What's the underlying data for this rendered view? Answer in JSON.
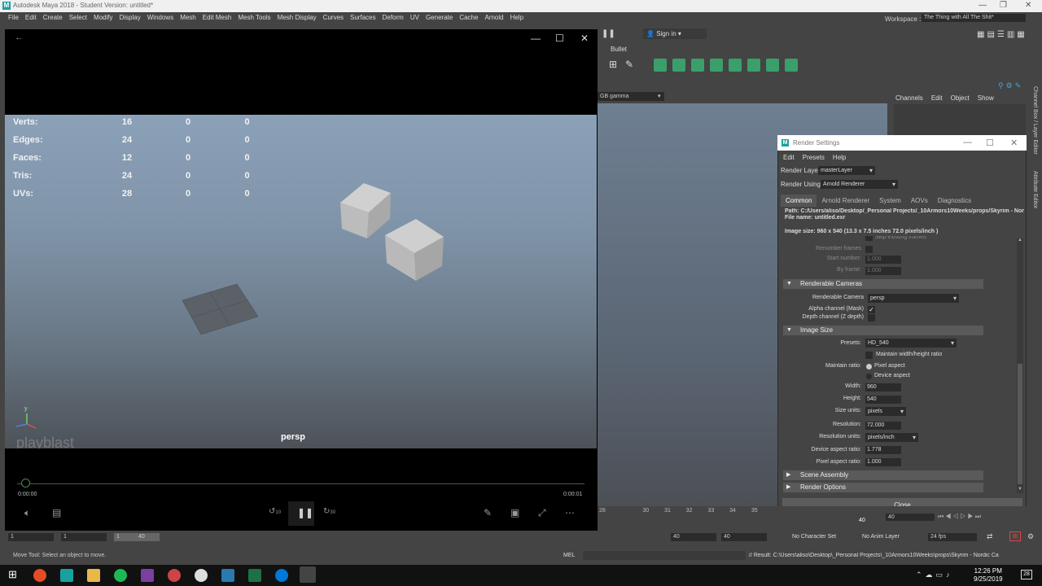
{
  "app": {
    "title": "Autodesk Maya 2018 - Student Version: untitled*",
    "logo_letter": "M",
    "menu": [
      "File",
      "Edit",
      "Create",
      "Select",
      "Modify",
      "Display",
      "Windows",
      "Mesh",
      "Edit Mesh",
      "Mesh Tools",
      "Mesh Display",
      "Curves",
      "Surfaces",
      "Deform",
      "UV",
      "Generate",
      "Cache",
      "Arnold",
      "Help"
    ],
    "workspace_label": "Workspace :",
    "workspace_value": "The Thing with All The Shit*",
    "sign_in": "Sign in",
    "shelf_tab": "Bullet",
    "gamma": "GB gamma",
    "channel_tabs": [
      "Channels",
      "Edit",
      "Object",
      "Show"
    ],
    "side_tabs": [
      "Channel Box / Layer Editor",
      "Attribute Editor"
    ]
  },
  "player": {
    "hud": [
      {
        "label": "Verts:",
        "v1": "16",
        "v2": "0",
        "v3": "0"
      },
      {
        "label": "Edges:",
        "v1": "24",
        "v2": "0",
        "v3": "0"
      },
      {
        "label": "Faces:",
        "v1": "12",
        "v2": "0",
        "v3": "0"
      },
      {
        "label": "Tris:",
        "v1": "24",
        "v2": "0",
        "v3": "0"
      },
      {
        "label": "UVs:",
        "v1": "28",
        "v2": "0",
        "v3": "0"
      }
    ],
    "camera": "persp",
    "watermark": "playblast",
    "time_start": "0:00:00",
    "time_end": "0:00:01",
    "skip_back": "10",
    "skip_fwd": "30",
    "axis_y": "y"
  },
  "render_settings": {
    "title": "Render Settings",
    "menu": [
      "Edit",
      "Presets",
      "Help"
    ],
    "render_layer_label": "Render Layer",
    "render_layer": "masterLayer",
    "render_using_label": "Render Using",
    "render_using": "Arnold Renderer",
    "tabs": [
      "Common",
      "Arnold Renderer",
      "System",
      "AOVs",
      "Diagnostics"
    ],
    "path": "Path: C:/Users/aliso/Desktop/_Personal Projects/_10Armors10Weeks/props/Skyrim - Nordic C",
    "file_name": "File name:  untitled.exr",
    "image_size": "Image size: 960 x 540 (13.3 x 7.5 inches 72.0 pixels/inch )",
    "skip_frames": "Skip existing frames",
    "renumber_frames": "Renumber frames",
    "start_number_label": "Start number:",
    "start_number": "1.000",
    "by_frame_label": "By frame:",
    "by_frame": "1.000",
    "cameras_section": "Renderable Cameras",
    "renderable_camera_label": "Renderable Camera",
    "renderable_camera": "persp",
    "alpha_label": "Alpha channel (Mask)",
    "depth_label": "Depth channel (Z depth)",
    "image_section": "Image Size",
    "presets_label": "Presets:",
    "presets": "HD_540",
    "maintain_wh": "Maintain width/height ratio",
    "maintain_ratio_label": "Maintain ratio:",
    "pixel_aspect": "Pixel aspect",
    "device_aspect": "Device aspect",
    "width_label": "Width:",
    "width": "960",
    "height_label": "Height:",
    "height": "540",
    "size_units_label": "Size units:",
    "size_units": "pixels",
    "resolution_label": "Resolution:",
    "resolution": "72.000",
    "res_units_label": "Resolution units:",
    "res_units": "pixels/inch",
    "dar_label": "Device aspect ratio:",
    "dar": "1.778",
    "par_label": "Pixel aspect ratio:",
    "par": "1.000",
    "scene_assembly": "Scene Assembly",
    "render_options": "Render Options",
    "close": "Close"
  },
  "timeline": {
    "ticks": [
      "28",
      "",
      "30",
      "31",
      "32",
      "33",
      "34",
      "35"
    ],
    "current_frame": "40",
    "range": {
      "start": "1",
      "start2": "1",
      "end": "40",
      "end2": "40"
    },
    "char_set": "No Character Set",
    "anim_layer": "No Anim Layer",
    "fps": "24 fps"
  },
  "status": {
    "help": "Move Tool: Select an object to move.",
    "mel": "MEL",
    "result": "// Result: C:\\Users\\aliso\\Desktop\\_Personal Projects\\_10Armors10Weeks\\props\\Skyrim - Nordic Ca"
  },
  "taskbar": {
    "time": "12:26 PM",
    "date": "9/25/2019",
    "notif": "28"
  }
}
